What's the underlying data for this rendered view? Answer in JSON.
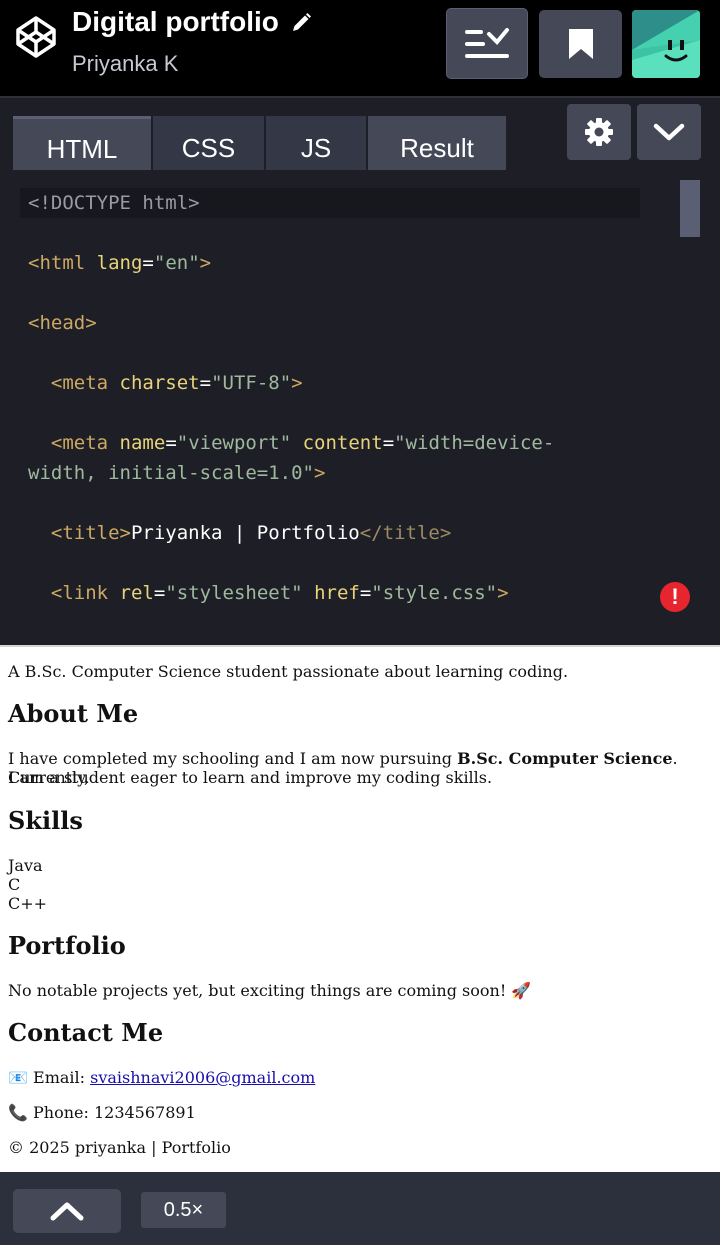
{
  "header": {
    "title": "Digital portfolio",
    "author": "Priyanka K"
  },
  "tabs": [
    {
      "label": "HTML"
    },
    {
      "label": "CSS"
    },
    {
      "label": "JS"
    },
    {
      "label": "Result"
    }
  ],
  "code_lines": {
    "l1": {
      "doctype": "<!DOCTYPE html>"
    },
    "l2": {
      "open": "<html",
      "attr": "lang",
      "eq": "=",
      "val": "\"en\"",
      "close": ">"
    },
    "l3": {
      "tag": "<head>"
    },
    "l4": {
      "open": "<meta",
      "attr": "charset",
      "eq": "=",
      "val": "\"UTF-8\"",
      "close": ">"
    },
    "l5": {
      "open": "<meta",
      "attr1": "name",
      "eq1": "=",
      "val1": "\"viewport\"",
      "attr2": "content",
      "eq2": "=",
      "val2a": "\"width=device-",
      "val2b": "width, initial-scale=1.0\"",
      "close": ">"
    },
    "l6": {
      "open": "<title>",
      "text": "Priyanka | Portfolio",
      "close": "</title>"
    },
    "l7": {
      "open": "<link",
      "attr1": "rel",
      "eq1": "=",
      "val1": "\"stylesheet\"",
      "attr2": "href",
      "eq2": "=",
      "val2": "\"style.css\"",
      "close": ">"
    }
  },
  "error_badge": "!",
  "result": {
    "tagline": "A B.Sc. Computer Science student passionate about learning coding.",
    "about_heading": "About Me",
    "about_text_1": "I have completed my schooling and I am now pursuing ",
    "about_bold": "B.Sc. Computer Science",
    "about_text_2": ". Currently,",
    "about_text_3": "I am a student eager to learn and improve my coding skills.",
    "skills_heading": "Skills",
    "skills": [
      "Java",
      "C",
      "C++"
    ],
    "portfolio_heading": "Portfolio",
    "portfolio_text": "No notable projects yet, but exciting things are coming soon! 🚀",
    "contact_heading": "Contact Me",
    "email_label": "📧 Email: ",
    "email": "svaishnavi2006@gmail.com",
    "phone": "📞 Phone: 1234567891",
    "footer": "© 2025 priyanka | Portfolio"
  },
  "bottom": {
    "zoom": "0.5×"
  },
  "colors": {
    "header_bg": "#000000",
    "editor_bg": "#1e1f26",
    "tab_bg": "#444857",
    "button_bg": "#444857",
    "error_red": "#e7252e",
    "tag_color": "#cca862",
    "attr_color": "#e8d27a",
    "string_color": "#9fb99f"
  },
  "icons": [
    "codepen-logo-icon",
    "pencil-icon",
    "layout-toggle-icon",
    "bookmark-icon",
    "avatar-icon",
    "gear-icon",
    "chevron-down-icon",
    "error-icon",
    "chevron-up-icon"
  ]
}
